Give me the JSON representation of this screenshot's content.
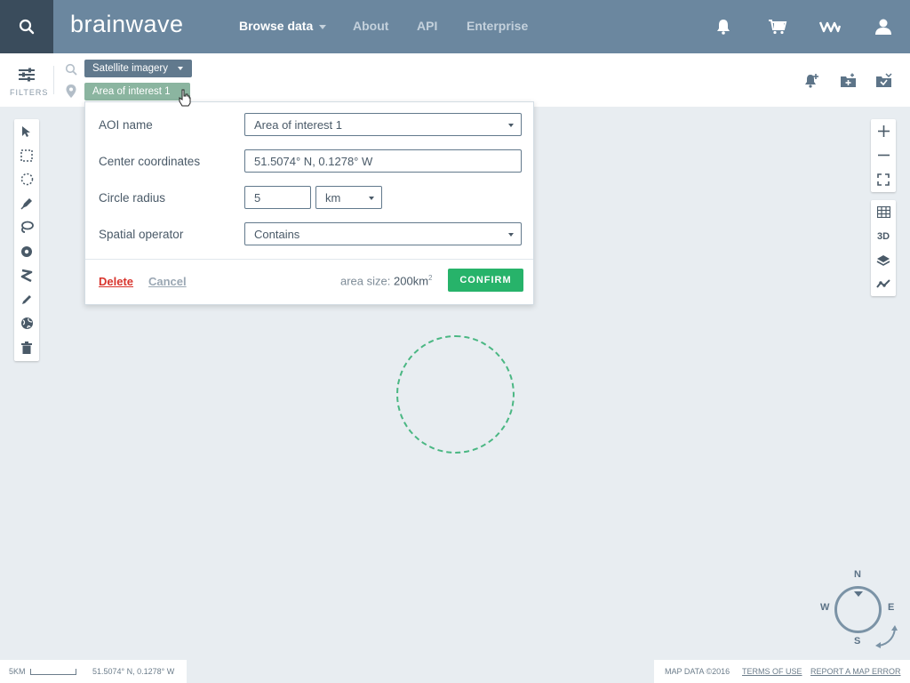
{
  "brand": {
    "logo_text": "brainwave"
  },
  "nav": {
    "items": [
      {
        "label": "Browse data",
        "active": true,
        "has_dropdown": true
      },
      {
        "label": "About"
      },
      {
        "label": "API"
      },
      {
        "label": "Enterprise"
      }
    ],
    "right_icons": [
      "notification-bell-icon",
      "cart-icon",
      "wave-logo-icon",
      "user-icon"
    ]
  },
  "filters": {
    "label": "FILTERS",
    "data_type_chip": "Satellite imagery",
    "aoi_chip": "Area of interest 1",
    "right_actions": [
      "add-alert-icon",
      "add-folder-icon",
      "save-folder-icon"
    ]
  },
  "aoi_panel": {
    "name_label": "AOI name",
    "name_value": "Area of interest 1",
    "center_label": "Center coordinates",
    "center_value": "51.5074° N, 0.1278° W",
    "radius_label": "Circle radius",
    "radius_value": "5",
    "radius_unit": "km",
    "operator_label": "Spatial operator",
    "operator_value": "Contains",
    "delete_label": "Delete",
    "cancel_label": "Cancel",
    "area_size_label": "area size:",
    "area_size_value": "200km",
    "area_size_sup": "2",
    "confirm_label": "CONFIRM"
  },
  "zoom_controls": {
    "threed_label": "3D"
  },
  "compass": {
    "n": "N",
    "e": "E",
    "s": "S",
    "w": "W"
  },
  "scalebar": {
    "scale_label": "5KM",
    "coords": "51.5074° N, 0.1278° W"
  },
  "credits": {
    "map_data": "MAP DATA ©2016",
    "terms": "TERMS OF USE",
    "report": "REPORT A MAP ERROR"
  },
  "colors": {
    "topbar": "#6b879f",
    "search": "#3a4c5c",
    "confirm": "#27b36a",
    "delete": "#d8342c",
    "aoi": "#4ab783"
  }
}
